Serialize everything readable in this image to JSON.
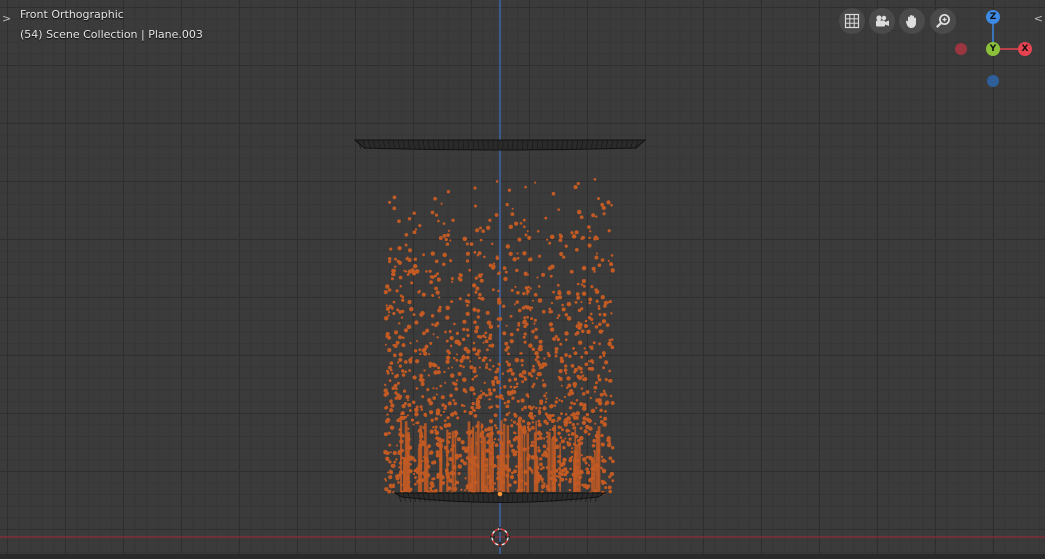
{
  "viewport": {
    "view_name": "Front Orthographic",
    "collection_label": "(54) Scene Collection | Plane.003"
  },
  "nav_icons": [
    "grid-icon",
    "camera-icon",
    "hand-pan-icon",
    "zoom-icon"
  ],
  "gizmo": {
    "z_label": "Z",
    "y_label": "Y",
    "x_label": "X",
    "colors": {
      "x": "#e5434f",
      "y": "#8bc13a",
      "z": "#3d89e3",
      "neg_x": "#9b3540",
      "neg_z": "#2f5f9a"
    }
  },
  "colors": {
    "particles": "#c25a24",
    "z_axis": "#3d6fc4",
    "x_axis": "#8f2a35",
    "mesh": "#1c1c1c"
  }
}
